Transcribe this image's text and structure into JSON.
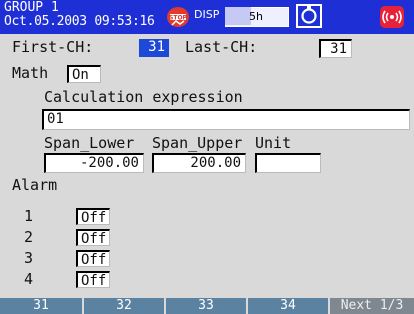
{
  "header": {
    "group_label": "GROUP 1",
    "datetime": "Oct.05.2003 09:53:16",
    "disp_label": "DISP",
    "time_value": "5h",
    "time_progress_percent": 40,
    "colors": {
      "bar": "#1f2fd6",
      "stop_icon": "#e0392e",
      "alarm_icon": "#e8213b"
    }
  },
  "channel": {
    "first_label": "First-CH:",
    "first_value": "31",
    "last_label": "Last-CH:",
    "last_value": "31"
  },
  "math": {
    "label": "Math",
    "value": "On",
    "expression_label": "Calculation expression",
    "expression_value": "01",
    "span_lower_label": "Span_Lower",
    "span_lower_value": "-200.00",
    "span_upper_label": "Span_Upper",
    "span_upper_value": "200.00",
    "unit_label": "Unit",
    "unit_value": ""
  },
  "alarm": {
    "label": "Alarm",
    "items": [
      {
        "num": "1",
        "value": "Off"
      },
      {
        "num": "2",
        "value": "Off"
      },
      {
        "num": "3",
        "value": "Off"
      },
      {
        "num": "4",
        "value": "Off"
      }
    ]
  },
  "softkeys": {
    "keys": [
      "31",
      "32",
      "33",
      "34"
    ],
    "next_label": "Next 1/3",
    "colors": {
      "key": "#5c82a2",
      "next": "#7f8790"
    }
  }
}
